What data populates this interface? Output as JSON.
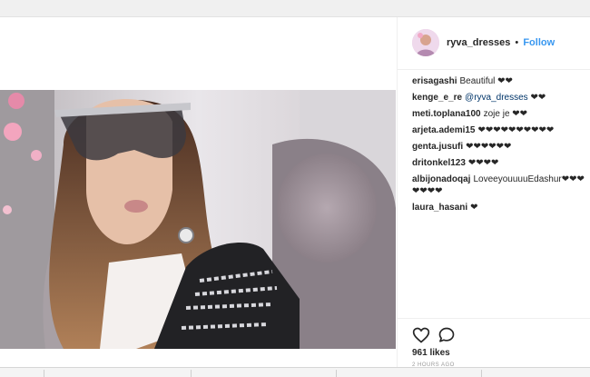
{
  "post": {
    "username": "ryva_dresses",
    "separator": "•",
    "follow_label": "Follow"
  },
  "comments": [
    {
      "user": "erisagashi",
      "text": "Beautiful ❤❤"
    },
    {
      "user": "kenge_e_re",
      "mention": "@ryva_dresses",
      "text": "❤❤"
    },
    {
      "user": "meti.toplana100",
      "text": "zoje je ❤❤"
    },
    {
      "user": "arjeta.ademi15",
      "text": "❤❤❤❤❤❤❤❤❤❤"
    },
    {
      "user": "genta.jusufi",
      "text": "❤❤❤❤❤❤"
    },
    {
      "user": "dritonkel123",
      "text": "❤❤❤❤"
    },
    {
      "user": "albijonadoqaj",
      "text": "LoveeyouuuuEdashur❤❤❤❤❤❤❤"
    },
    {
      "user": "laura_hasani",
      "text": "❤"
    }
  ],
  "likes": "961 likes",
  "time_ago": "2 HOURS AGO",
  "icons": [
    "heart-icon",
    "comment-icon"
  ],
  "colors": {
    "accent": "#3897f0",
    "mention": "#003569"
  }
}
